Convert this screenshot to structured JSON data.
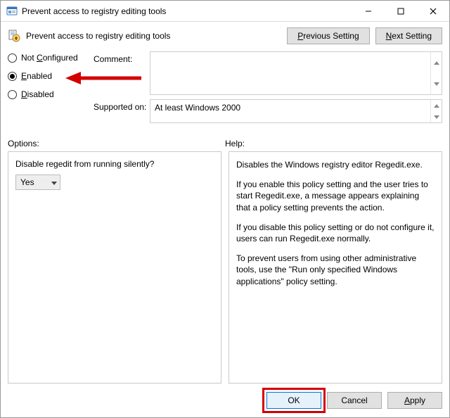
{
  "window": {
    "title": "Prevent access to registry editing tools"
  },
  "header": {
    "policy_title": "Prevent access to registry editing tools",
    "prev_btn_pre": "",
    "prev_btn_ul": "P",
    "prev_btn_post": "revious Setting",
    "next_btn_pre": "",
    "next_btn_ul": "N",
    "next_btn_post": "ext Setting"
  },
  "radios": {
    "not_configured_pre": "Not ",
    "not_configured_ul": "C",
    "not_configured_post": "onfigured",
    "enabled_ul": "E",
    "enabled_post": "nabled",
    "disabled_ul": "D",
    "disabled_post": "isabled",
    "selected": "enabled"
  },
  "labels": {
    "comment": "Comment:",
    "supported": "Supported on:",
    "options": "Options:",
    "help": "Help:"
  },
  "fields": {
    "comment": "",
    "supported_on": "At least Windows 2000"
  },
  "options": {
    "label": "Disable regedit from running silently?",
    "value": "Yes"
  },
  "help": {
    "p1": "Disables the Windows registry editor Regedit.exe.",
    "p2": "If you enable this policy setting and the user tries to start Regedit.exe, a message appears explaining that a policy setting prevents the action.",
    "p3": "If you disable this policy setting or do not configure it, users can run Regedit.exe normally.",
    "p4": "To prevent users from using other administrative tools, use the \"Run only specified Windows applications\" policy setting."
  },
  "buttons": {
    "ok": "OK",
    "cancel": "Cancel",
    "apply_ul": "A",
    "apply_post": "pply"
  },
  "annotations": {
    "arrow_color": "#d40000",
    "ok_box_color": "#d40000"
  }
}
